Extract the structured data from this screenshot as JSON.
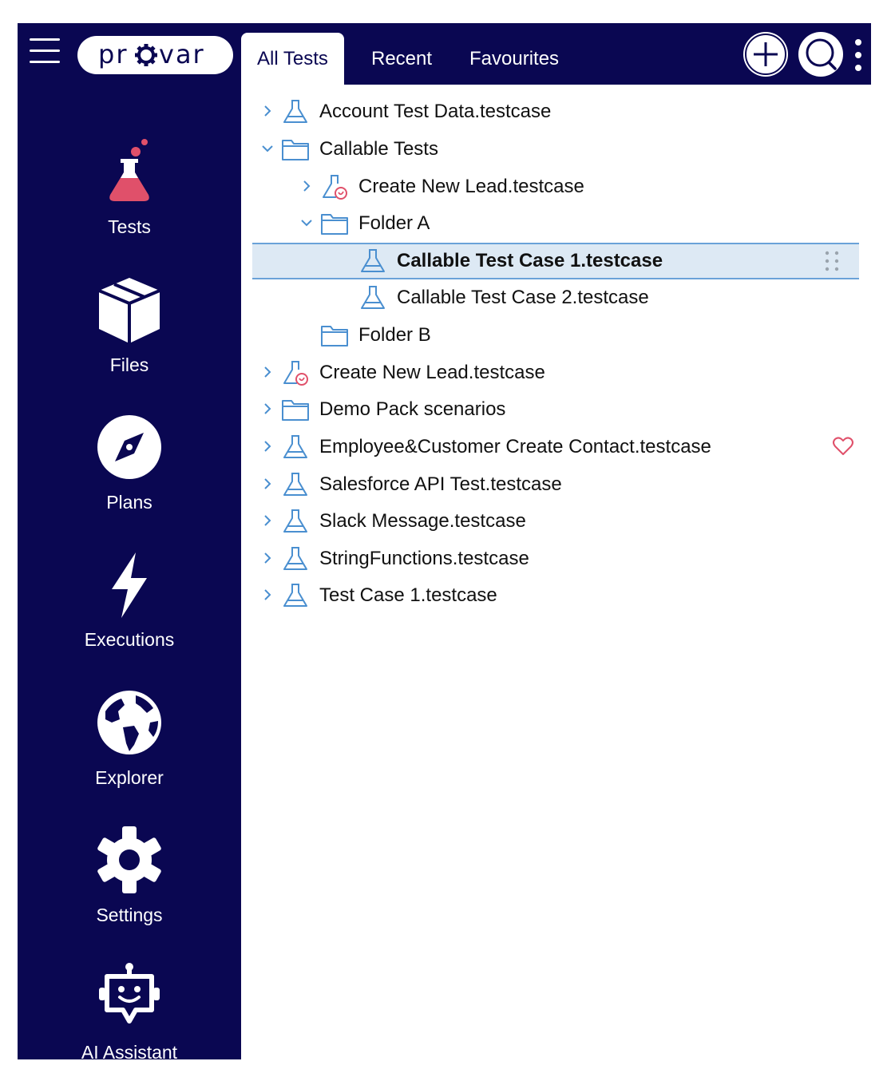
{
  "header": {
    "logo_text": "pr⚙var",
    "tabs": [
      {
        "label": "All Tests",
        "active": true
      },
      {
        "label": "Recent",
        "active": false
      },
      {
        "label": "Favourites",
        "active": false
      }
    ],
    "icons": [
      "menu-icon",
      "plus-icon",
      "search-icon",
      "more-vertical-icon"
    ]
  },
  "sidebar": {
    "items": [
      {
        "label": "Tests",
        "icon": "flask-icon"
      },
      {
        "label": "Files",
        "icon": "box-icon"
      },
      {
        "label": "Plans",
        "icon": "compass-icon"
      },
      {
        "label": "Executions",
        "icon": "lightning-icon"
      },
      {
        "label": "Explorer",
        "icon": "globe-icon"
      },
      {
        "label": "Settings",
        "icon": "gear-icon"
      },
      {
        "label": "AI Assistant",
        "icon": "robot-icon"
      }
    ]
  },
  "tree": {
    "rows": [
      {
        "label": "Account Test Data.testcase",
        "type": "testcase",
        "depth": 0,
        "expander": "collapsed"
      },
      {
        "label": "Callable Tests",
        "type": "folder",
        "depth": 0,
        "expander": "expanded"
      },
      {
        "label": "Create New Lead.testcase",
        "type": "callable-testcase",
        "depth": 1,
        "expander": "collapsed"
      },
      {
        "label": "Folder A",
        "type": "folder",
        "depth": 1,
        "expander": "expanded"
      },
      {
        "label": "Callable Test Case 1.testcase",
        "type": "testcase",
        "depth": 2,
        "expander": "none",
        "selected": true
      },
      {
        "label": "Callable Test Case 2.testcase",
        "type": "testcase",
        "depth": 2,
        "expander": "none"
      },
      {
        "label": "Folder B",
        "type": "folder",
        "depth": 1,
        "expander": "none"
      },
      {
        "label": "Create New Lead.testcase",
        "type": "callable-testcase",
        "depth": 0,
        "expander": "collapsed"
      },
      {
        "label": "Demo Pack scenarios",
        "type": "folder",
        "depth": 0,
        "expander": "collapsed"
      },
      {
        "label": "Employee&Customer Create Contact.testcase",
        "type": "testcase",
        "depth": 0,
        "expander": "collapsed",
        "favourite": true
      },
      {
        "label": "Salesforce API Test.testcase",
        "type": "testcase",
        "depth": 0,
        "expander": "collapsed"
      },
      {
        "label": "Slack Message.testcase",
        "type": "testcase",
        "depth": 0,
        "expander": "collapsed"
      },
      {
        "label": "StringFunctions.testcase",
        "type": "testcase",
        "depth": 0,
        "expander": "collapsed"
      },
      {
        "label": "Test Case 1.testcase",
        "type": "testcase",
        "depth": 0,
        "expander": "collapsed"
      }
    ]
  },
  "colors": {
    "nav_bg": "#0a0752",
    "selected_bg": "#dde9f4",
    "selected_border": "#6aa2d8",
    "tree_icon": "#4a8fd0",
    "accent_red": "#e0506a"
  }
}
